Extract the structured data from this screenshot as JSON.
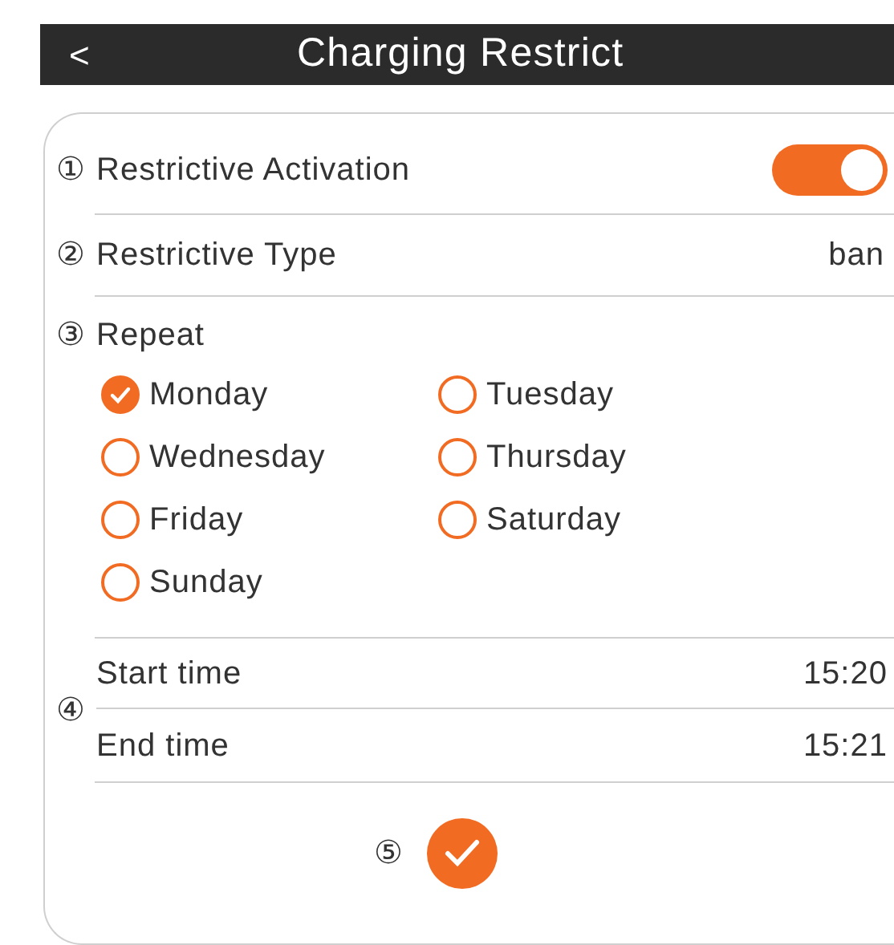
{
  "header": {
    "back": "<",
    "title": "Charging Restrict"
  },
  "activation": {
    "marker": "①",
    "label": "Restrictive Activation",
    "on": true
  },
  "type": {
    "marker": "②",
    "label": "Restrictive Type",
    "value": "ban"
  },
  "repeat": {
    "marker": "③",
    "label": "Repeat",
    "days": [
      {
        "label": "Monday",
        "checked": true
      },
      {
        "label": "Tuesday",
        "checked": false
      },
      {
        "label": "Wednesday",
        "checked": false
      },
      {
        "label": "Thursday",
        "checked": false
      },
      {
        "label": "Friday",
        "checked": false
      },
      {
        "label": "Saturday",
        "checked": false
      },
      {
        "label": "Sunday",
        "checked": false
      }
    ]
  },
  "time": {
    "marker": "④",
    "start_label": "Start time",
    "start_value": "15:20",
    "end_label": "End time",
    "end_value": "15:21"
  },
  "confirm": {
    "marker": "⑤"
  }
}
